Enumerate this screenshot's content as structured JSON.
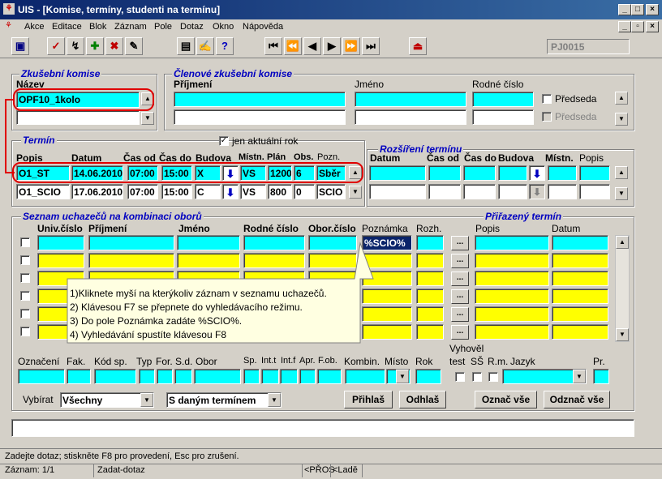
{
  "window": {
    "title": "UIS - [Komise, termíny, studenti na termínu]"
  },
  "menu": [
    "Akce",
    "Editace",
    "Blok",
    "Záznam",
    "Pole",
    "Dotaz",
    "Okno",
    "Nápověda"
  ],
  "toolbar": {
    "form_id": "PJ0015"
  },
  "komise": {
    "title": "Zkušební komise",
    "nazev_label": "Název",
    "nazev_value": "OPF10_1kolo"
  },
  "clenove": {
    "title": "Členové zkušební komise",
    "prijmeni": "Příjmení",
    "jmeno": "Jméno",
    "rodne": "Rodné číslo",
    "predseda": "Předseda"
  },
  "termin": {
    "title": "Termín",
    "aktualni": "jen aktuální rok",
    "headers": [
      "Popis",
      "Datum",
      "Čas od",
      "Čas do",
      "Budova",
      "Místn.",
      "Plán",
      "Obs.",
      "Pozn."
    ],
    "rows": [
      {
        "popis": "O1_ST",
        "datum": "14.06.2010",
        "od": "07:00",
        "do": "15:00",
        "budova": "X",
        "mistn": "VS",
        "plan": "1200",
        "obs": "6",
        "pozn": "Sběr"
      },
      {
        "popis": "O1_SCIO",
        "datum": "17.06.2010",
        "od": "07:00",
        "do": "15:00",
        "budova": "C",
        "mistn": "VS",
        "plan": "800",
        "obs": "0",
        "pozn": "SCIO"
      }
    ]
  },
  "rozsireni": {
    "title": "Rozšíření termínu",
    "headers": [
      "Datum",
      "Čas od",
      "Čas do",
      "Budova",
      "Místn.",
      "Popis"
    ]
  },
  "seznam": {
    "title": "Seznam uchazečů na kombinaci oborů",
    "headers": [
      "Univ.číslo",
      "Příjmení",
      "Jméno",
      "Rodné číslo",
      "Obor.číslo",
      "Poznámka",
      "Rozh."
    ],
    "poznamka_value": "%SCIO%",
    "prirazeny": {
      "title": "Přiřazený termín",
      "popis": "Popis",
      "datum": "Datum"
    }
  },
  "tooltip": {
    "lines": [
      "1)Kliknete myší na kterýkoliv záznam v seznamu uchazečů.",
      "2) Klávesou F7 se přepnete do vyhledávacího režimu.",
      "3) Do pole Poznámka zadáte %SCIO%.",
      "4) Vyhledávání spustíte klávesou F8"
    ]
  },
  "bottom": {
    "labels": [
      "Označení",
      "Fak.",
      "Kód sp.",
      "Typ",
      "For.",
      "S.d.",
      "Obor",
      "Sp.",
      "Int.t",
      "Int.f",
      "Apr.",
      "F.ob.",
      "Kombin.",
      "Místo",
      "Rok"
    ],
    "vyhovel": "Vyhověl",
    "test": "test",
    "ss": "SŠ",
    "rm": "R.m.",
    "jazyk": "Jazyk",
    "pr": "Pr.",
    "vybirat": "Vybírat",
    "vybirat_value": "Všechny",
    "termin_value": "S daným termínem",
    "btn_prihlas": "Přihlaš",
    "btn_odhlas": "Odhlaš",
    "btn_oznac": "Označ vše",
    "btn_odznac": "Odznač vše"
  },
  "status": {
    "hint": "Zadejte dotaz; stiskněte F8 pro provedení, Esc pro zrušení.",
    "zaznam": "Záznam: 1/1",
    "mode": "Zadat-dotaz",
    "pros": "<PŘOS",
    "lade": "<Ladě"
  }
}
